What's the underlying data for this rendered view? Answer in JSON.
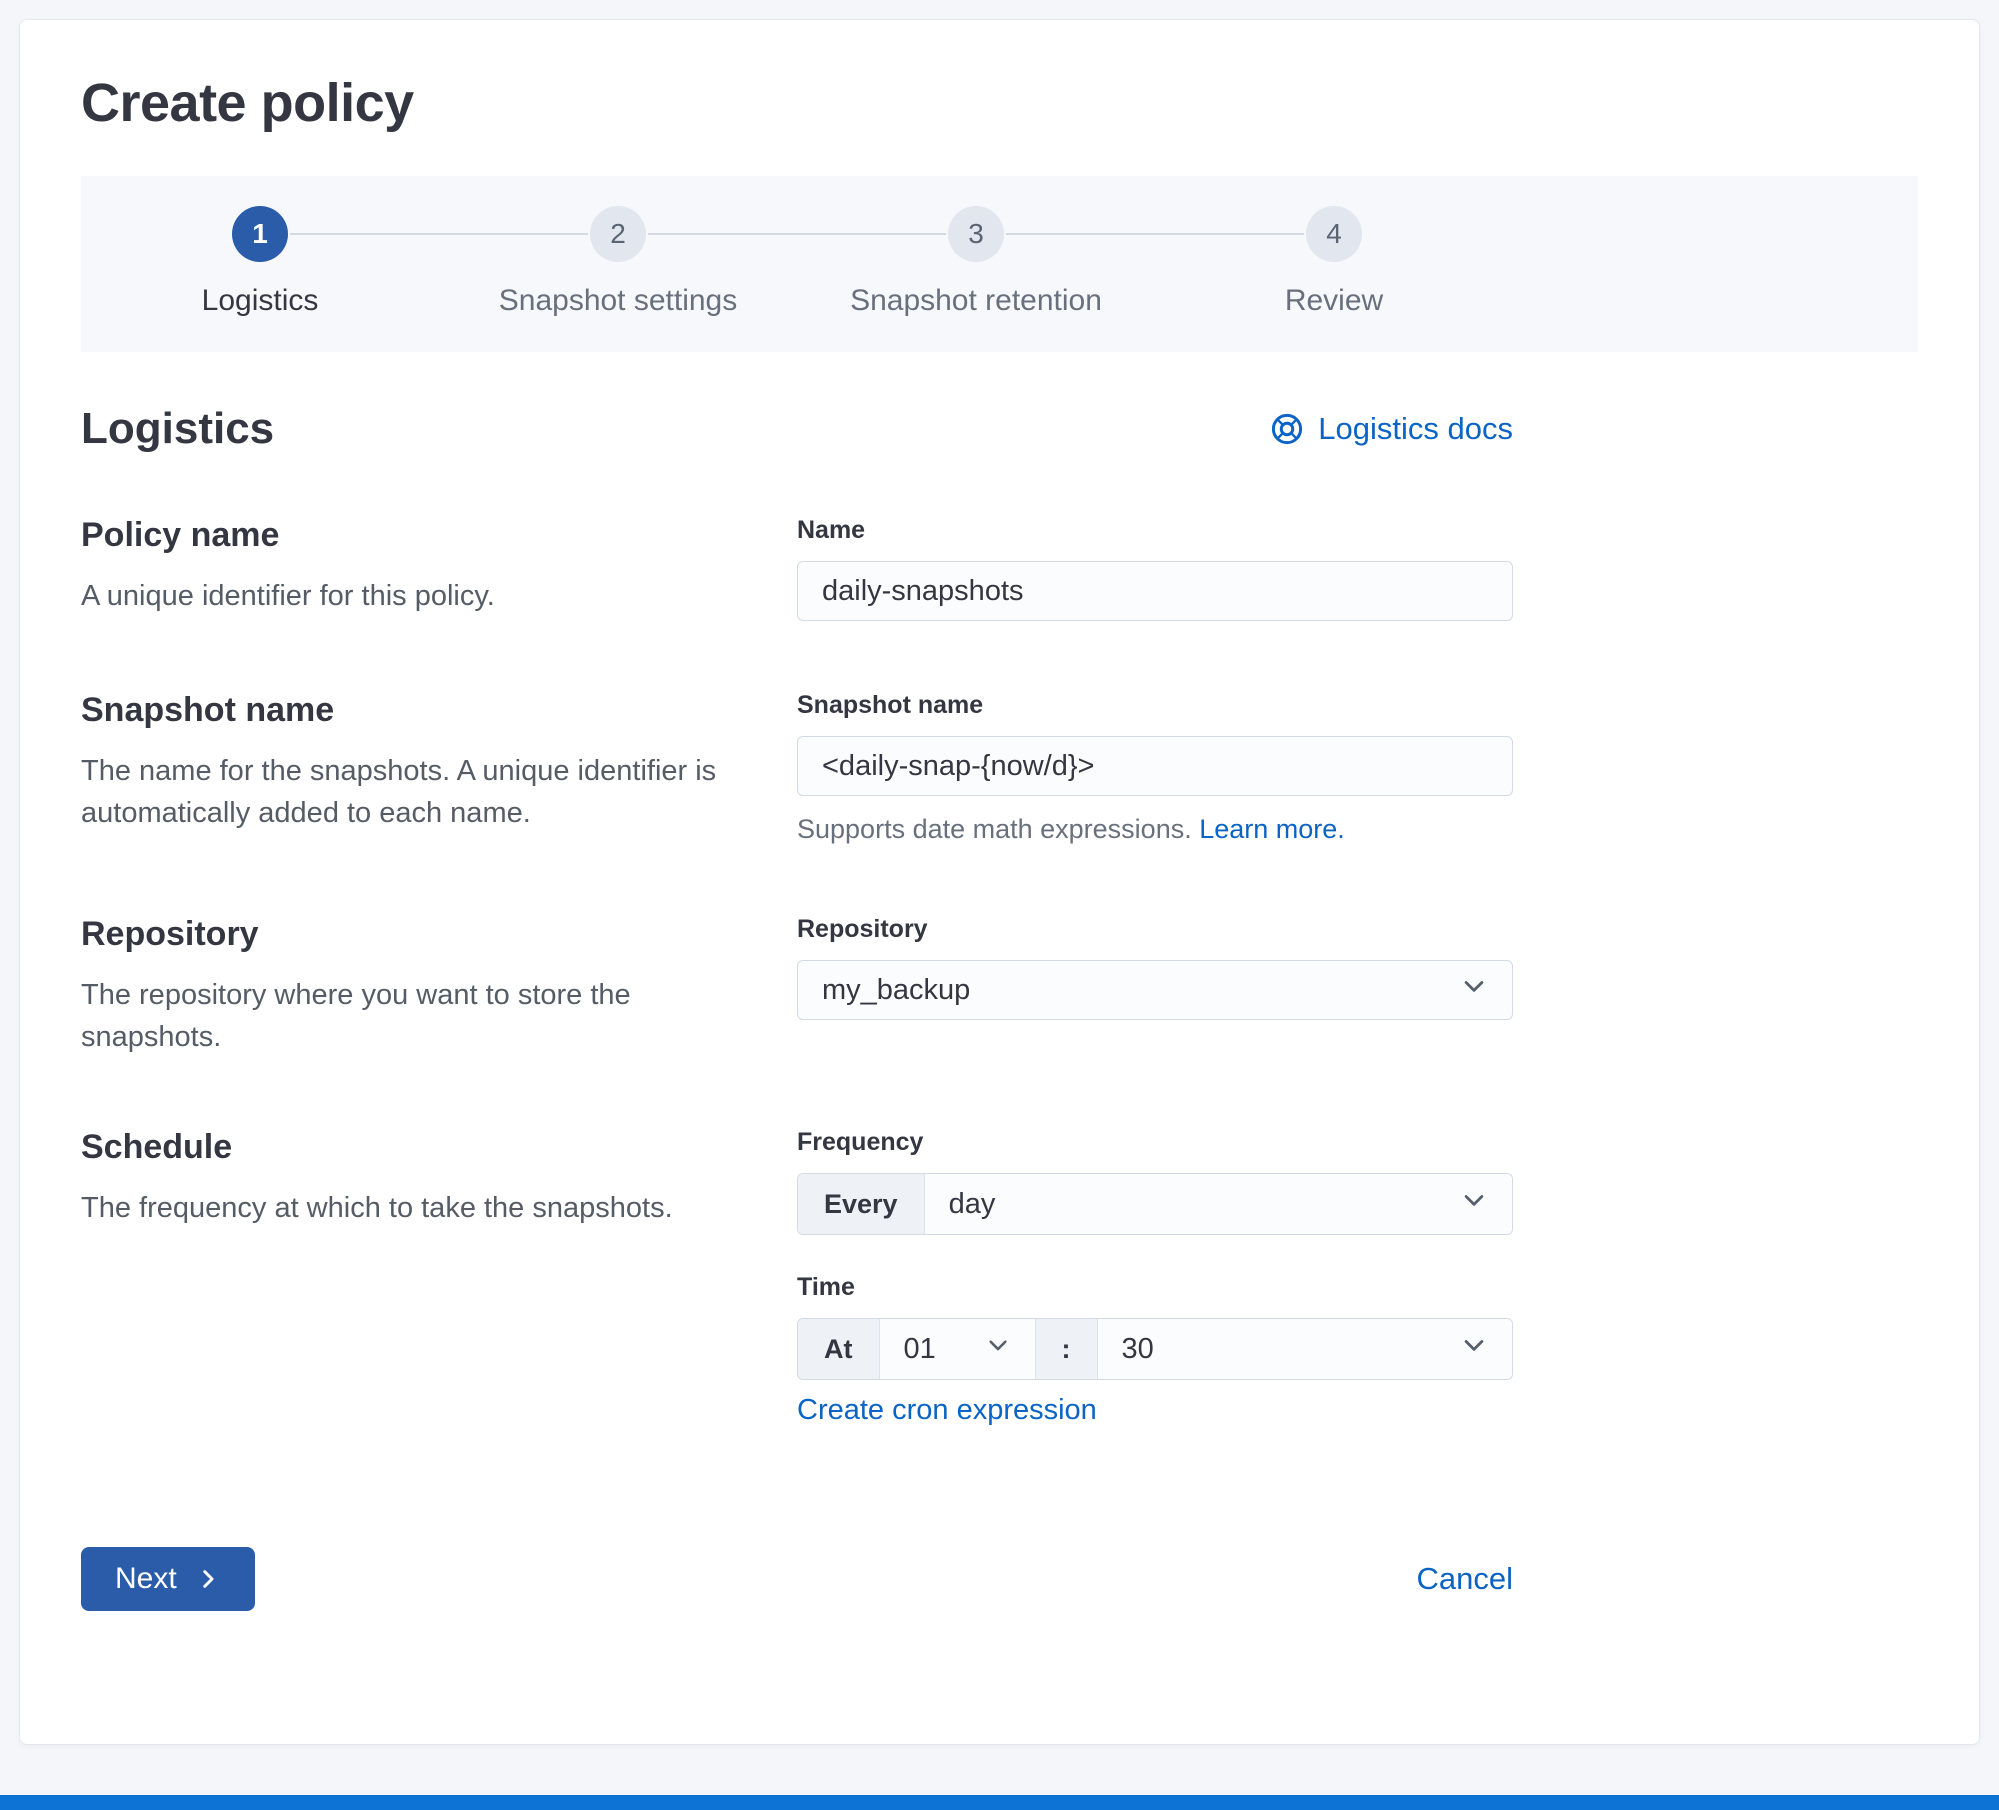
{
  "page": {
    "title": "Create policy"
  },
  "steps": [
    {
      "number": "1",
      "label": "Logistics",
      "state": "active"
    },
    {
      "number": "2",
      "label": "Snapshot settings",
      "state": "incomplete"
    },
    {
      "number": "3",
      "label": "Snapshot retention",
      "state": "incomplete"
    },
    {
      "number": "4",
      "label": "Review",
      "state": "incomplete"
    }
  ],
  "section": {
    "title": "Logistics",
    "docs_link_label": "Logistics docs"
  },
  "form": {
    "policy_name": {
      "title": "Policy name",
      "description": "A unique identifier for this policy.",
      "label": "Name",
      "value": "daily-snapshots"
    },
    "snapshot_name": {
      "title": "Snapshot name",
      "description": "The name for the snapshots. A unique identifier is automatically added to each name.",
      "label": "Snapshot name",
      "value": "<daily-snap-{now/d}>",
      "help": "Supports date math expressions. ",
      "help_link": "Learn more."
    },
    "repository": {
      "title": "Repository",
      "description": "The repository where you want to store the snapshots.",
      "label": "Repository",
      "value": "my_backup"
    },
    "schedule": {
      "title": "Schedule",
      "description": "The frequency at which to take the snapshots.",
      "frequency_label": "Frequency",
      "frequency_prepend": "Every",
      "frequency_value": "day",
      "time_label": "Time",
      "time_prepend": "At",
      "hour_value": "01",
      "time_separator": ":",
      "minute_value": "30",
      "cron_link_label": "Create cron expression"
    }
  },
  "footer": {
    "next_label": "Next",
    "cancel_label": "Cancel"
  },
  "colors": {
    "primary": "#2a5caa",
    "link": "#0b64c5",
    "bottom_bar": "#0d74d6",
    "step_inactive": "#e1e6ef",
    "input_border": "#d3dae6"
  }
}
